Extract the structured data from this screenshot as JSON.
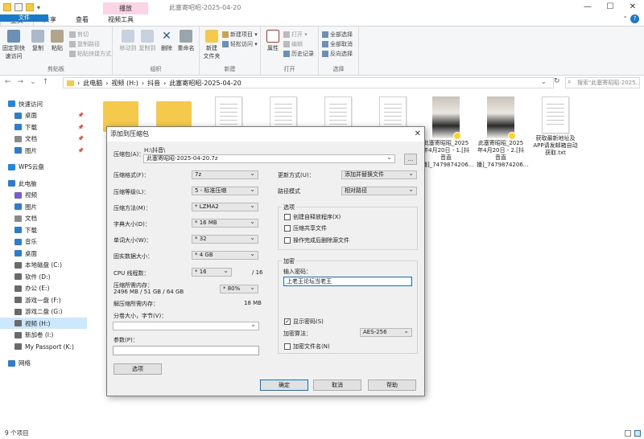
{
  "window": {
    "title": "此塞寄昭昭-2025-04-20",
    "context_tab": "播放",
    "controls": [
      "—",
      "☐",
      "✕"
    ]
  },
  "ribbon_tabs": [
    "文件",
    "主页",
    "共享",
    "查看",
    "视频工具"
  ],
  "ribbon": {
    "clipboard": {
      "pin": "固定到快速访问",
      "copy": "复制",
      "paste": "粘贴",
      "cut": "剪切",
      "copy_path": "复制路径",
      "paste_shortcut": "粘贴快捷方式",
      "label": "剪贴板"
    },
    "organize": {
      "move_to": "移动到",
      "copy_to": "复制到",
      "delete": "删除",
      "rename": "重命名",
      "label": "组织"
    },
    "new": {
      "new_folder": "新建\n文件夹",
      "new_item": "新建项目 ▾",
      "easy_access": "轻松访问 ▾",
      "label": "新建"
    },
    "open": {
      "properties": "属性",
      "open": "打开 ▾",
      "edit": "编辑",
      "history": "历史记录",
      "label": "打开"
    },
    "select": {
      "select_all": "全部选择",
      "select_none": "全部取消",
      "invert": "反向选择",
      "label": "选择"
    }
  },
  "nav": {
    "back": "←",
    "forward": "→",
    "recent": "⌄",
    "up": "↑"
  },
  "address": {
    "crumbs": [
      "此电脑",
      "视频 (H:)",
      "抖音",
      "此塞寄昭昭-2025-04-20"
    ],
    "search_placeholder": "搜索\"此塞寄昭昭-2025..."
  },
  "sidebar": {
    "items": [
      {
        "label": "快速访问",
        "icon": "star-icon",
        "color": "#1e88e5"
      },
      {
        "label": "桌面",
        "icon": "desktop-icon",
        "color": "#2b7cd3"
      },
      {
        "label": "下载",
        "icon": "download-icon",
        "color": "#2b7cd3"
      },
      {
        "label": "文档",
        "icon": "document-icon",
        "color": "#8a8a8a"
      },
      {
        "label": "图片",
        "icon": "picture-icon",
        "color": "#2b7cd3"
      },
      {
        "label": "WPS云盘",
        "icon": "cloud-icon",
        "color": "#1e88e5"
      },
      {
        "label": "此电脑",
        "icon": "computer-icon",
        "color": "#2b7cd3"
      },
      {
        "label": "视频",
        "icon": "video-icon",
        "color": "#7a5bd6"
      },
      {
        "label": "图片",
        "icon": "picture-icon",
        "color": "#2b7cd3"
      },
      {
        "label": "文档",
        "icon": "document-icon",
        "color": "#8a8a8a"
      },
      {
        "label": "下载",
        "icon": "download-icon",
        "color": "#2b7cd3"
      },
      {
        "label": "音乐",
        "icon": "music-icon",
        "color": "#2b7cd3"
      },
      {
        "label": "桌面",
        "icon": "desktop-icon",
        "color": "#2b7cd3"
      },
      {
        "label": "本地磁盘 (C:)",
        "icon": "drive-icon",
        "color": "#6a6a6a"
      },
      {
        "label": "软件 (D:)",
        "icon": "drive-icon",
        "color": "#6a6a6a"
      },
      {
        "label": "办公 (E:)",
        "icon": "drive-icon",
        "color": "#6a6a6a"
      },
      {
        "label": "游戏一盘 (F:)",
        "icon": "drive-icon",
        "color": "#6a6a6a"
      },
      {
        "label": "游戏二盘 (G:)",
        "icon": "drive-icon",
        "color": "#6a6a6a"
      },
      {
        "label": "视频 (H:)",
        "icon": "drive-icon",
        "color": "#6a6a6a"
      },
      {
        "label": "新加卷 (I:)",
        "icon": "drive-icon",
        "color": "#6a6a6a"
      },
      {
        "label": "My Passport (K:)",
        "icon": "drive-icon",
        "color": "#6a6a6a"
      },
      {
        "label": "网络",
        "icon": "network-icon",
        "color": "#2b7cd3"
      }
    ],
    "selected_index": 18
  },
  "files": [
    {
      "name": "",
      "type": "folder"
    },
    {
      "name": "",
      "type": "folder"
    },
    {
      "name": "",
      "type": "doc"
    },
    {
      "name": "",
      "type": "doc"
    },
    {
      "name": "",
      "type": "doc"
    },
    {
      "name": "",
      "type": "doc"
    },
    {
      "name": "此塞寄昭昭_2025年4月20日 - 1.[抖音直播]_7479874206...",
      "type": "video"
    },
    {
      "name": "此塞寄昭昭_2025年4月20日 - 2.[抖音直播]_7479874206...",
      "type": "video"
    },
    {
      "name": "获取最新地址及APP请发邮箱自动获取.txt",
      "type": "doc"
    }
  ],
  "status": "9 个项目",
  "dialog": {
    "title": "添加到压缩包",
    "close": "✕",
    "archive_label": "压缩包(A)：",
    "archive_path": "H:\\抖音\\",
    "archive_name": "此塞寄昭昭-2025-04-20.7z",
    "browse": "...",
    "format_label": "压缩格式(F)：",
    "format_value": "7z",
    "level_label": "压缩等级(L)：",
    "level_value": "5 - 标准压缩",
    "method_label": "压缩方法(M)：",
    "method_value": "* LZMA2",
    "dict_label": "字典大小(D)：",
    "dict_value": "* 16 MB",
    "word_label": "单词大小(W)：",
    "word_value": "* 32",
    "solid_label": "固实数据大小：",
    "solid_value": "* 4 GB",
    "cpu_label": "CPU 线程数：",
    "cpu_value": "* 16",
    "cpu_total": "/ 16",
    "mem_label": "压缩所需内存：",
    "mem_detail": "2496 MB / 51 GB / 64 GB",
    "mem_pct": "* 80%",
    "decomp_label": "解压缩所需内存：",
    "decomp_value": "18 MB",
    "split_label": "分卷大小，字节(V)：",
    "split_value": "",
    "params_label": "参数(P)：",
    "params_value": "",
    "options_btn": "选项",
    "update_label": "更新方式(U)：",
    "update_value": "添加并替换文件",
    "path_label": "路径模式",
    "path_value": "相对路径",
    "options_group": "选项",
    "opt_sfx": "创建自释放程序(X)",
    "opt_shared": "压缩共享文件",
    "opt_delete": "操作完成后删除源文件",
    "enc_group": "加密",
    "pwd_label": "输入密码：",
    "pwd_value": "上老王论坛当老王",
    "show_pwd": "显示密码(S)",
    "enc_method_label": "加密算法：",
    "enc_method_value": "AES-256",
    "enc_names": "加密文件名(N)",
    "ok": "确定",
    "cancel": "取消",
    "help": "帮助"
  }
}
